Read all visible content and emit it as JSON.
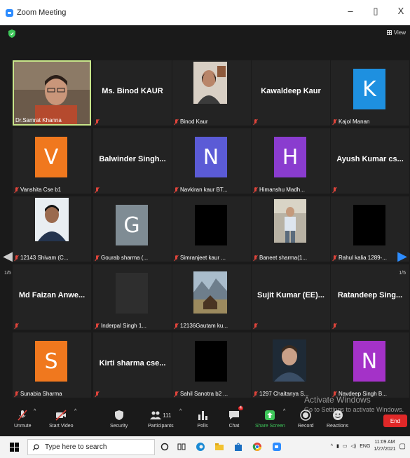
{
  "window": {
    "title": "Zoom Meeting",
    "minimize": "–",
    "restore": "▯",
    "close": "X"
  },
  "meeting": {
    "view_label": "View",
    "page_left": "1/5",
    "page_right": "1/5"
  },
  "participants": [
    {
      "display_name": "",
      "label": "Dr.Samrat Khanna",
      "type": "video",
      "active": true
    },
    {
      "display_name": "Ms. Binod KAUR",
      "label": "",
      "type": "name"
    },
    {
      "display_name": "",
      "label": "Binod Kaur",
      "type": "photo"
    },
    {
      "display_name": "Kawaldeep Kaur",
      "label": "",
      "type": "name"
    },
    {
      "display_name": "K",
      "label": "Kajol Manan",
      "type": "letter",
      "color": "#1e90e0"
    },
    {
      "display_name": "V",
      "label": "Vanshita Cse b1",
      "type": "letter",
      "color": "#f0781e"
    },
    {
      "display_name": "Balwinder Singh...",
      "label": "",
      "type": "name"
    },
    {
      "display_name": "N",
      "label": "Navkiran kaur BT...",
      "type": "letter",
      "color": "#5b5bd6"
    },
    {
      "display_name": "H",
      "label": "Himanshu Madh...",
      "type": "letter",
      "color": "#8a3ccf"
    },
    {
      "display_name": "Ayush Kumar cs...",
      "label": "",
      "type": "name"
    },
    {
      "display_name": "",
      "label": "12143 Shivam (C...",
      "type": "photo"
    },
    {
      "display_name": "G",
      "label": "Gourab sharma (...",
      "type": "letter",
      "color": "#7f8c94"
    },
    {
      "display_name": "",
      "label": "Simranjeet kaur ...",
      "type": "black"
    },
    {
      "display_name": "",
      "label": "Baneet sharma(1...",
      "type": "photo"
    },
    {
      "display_name": "",
      "label": "Rahul kalia 1289-...",
      "type": "black"
    },
    {
      "display_name": "Md Faizan Anwe...",
      "label": "",
      "type": "name"
    },
    {
      "display_name": "",
      "label": "Inderpal Singh 1...",
      "type": "dark"
    },
    {
      "display_name": "",
      "label": "12136Gautam ku...",
      "type": "photo"
    },
    {
      "display_name": "Sujit Kumar (EE)...",
      "label": "",
      "type": "name"
    },
    {
      "display_name": "Ratandeep Sing...",
      "label": "",
      "type": "name"
    },
    {
      "display_name": "S",
      "label": "Sunabia Sharma",
      "type": "letter",
      "color": "#f0781e"
    },
    {
      "display_name": "Kirti sharma cse...",
      "label": "",
      "type": "name"
    },
    {
      "display_name": "",
      "label": "Sahil Sanotra b2 ...",
      "type": "black"
    },
    {
      "display_name": "",
      "label": "1297 Chaitanya S...",
      "type": "photo"
    },
    {
      "display_name": "N",
      "label": "Navdeep Singh B...",
      "type": "letter",
      "color": "#a432c8"
    }
  ],
  "toolbar": {
    "unmute": "Unmute",
    "start_video": "Start Video",
    "security": "Security",
    "participants": "Participants",
    "participants_count": "111",
    "polls": "Polls",
    "chat": "Chat",
    "chat_badge": "4",
    "share_screen": "Share Screen",
    "record": "Record",
    "reactions": "Reactions",
    "end": "End"
  },
  "watermark": {
    "line1": "Activate Windows",
    "line2": "Go to Settings to activate Windows."
  },
  "taskbar": {
    "search_placeholder": "Type here to search",
    "language": "ENG",
    "time": "11:09 AM",
    "date": "1/27/2021"
  },
  "colors": {
    "accent": "#3ec75a",
    "end": "#e02828",
    "active_border": "#c7e58a",
    "mic_off": "#e0443b"
  }
}
